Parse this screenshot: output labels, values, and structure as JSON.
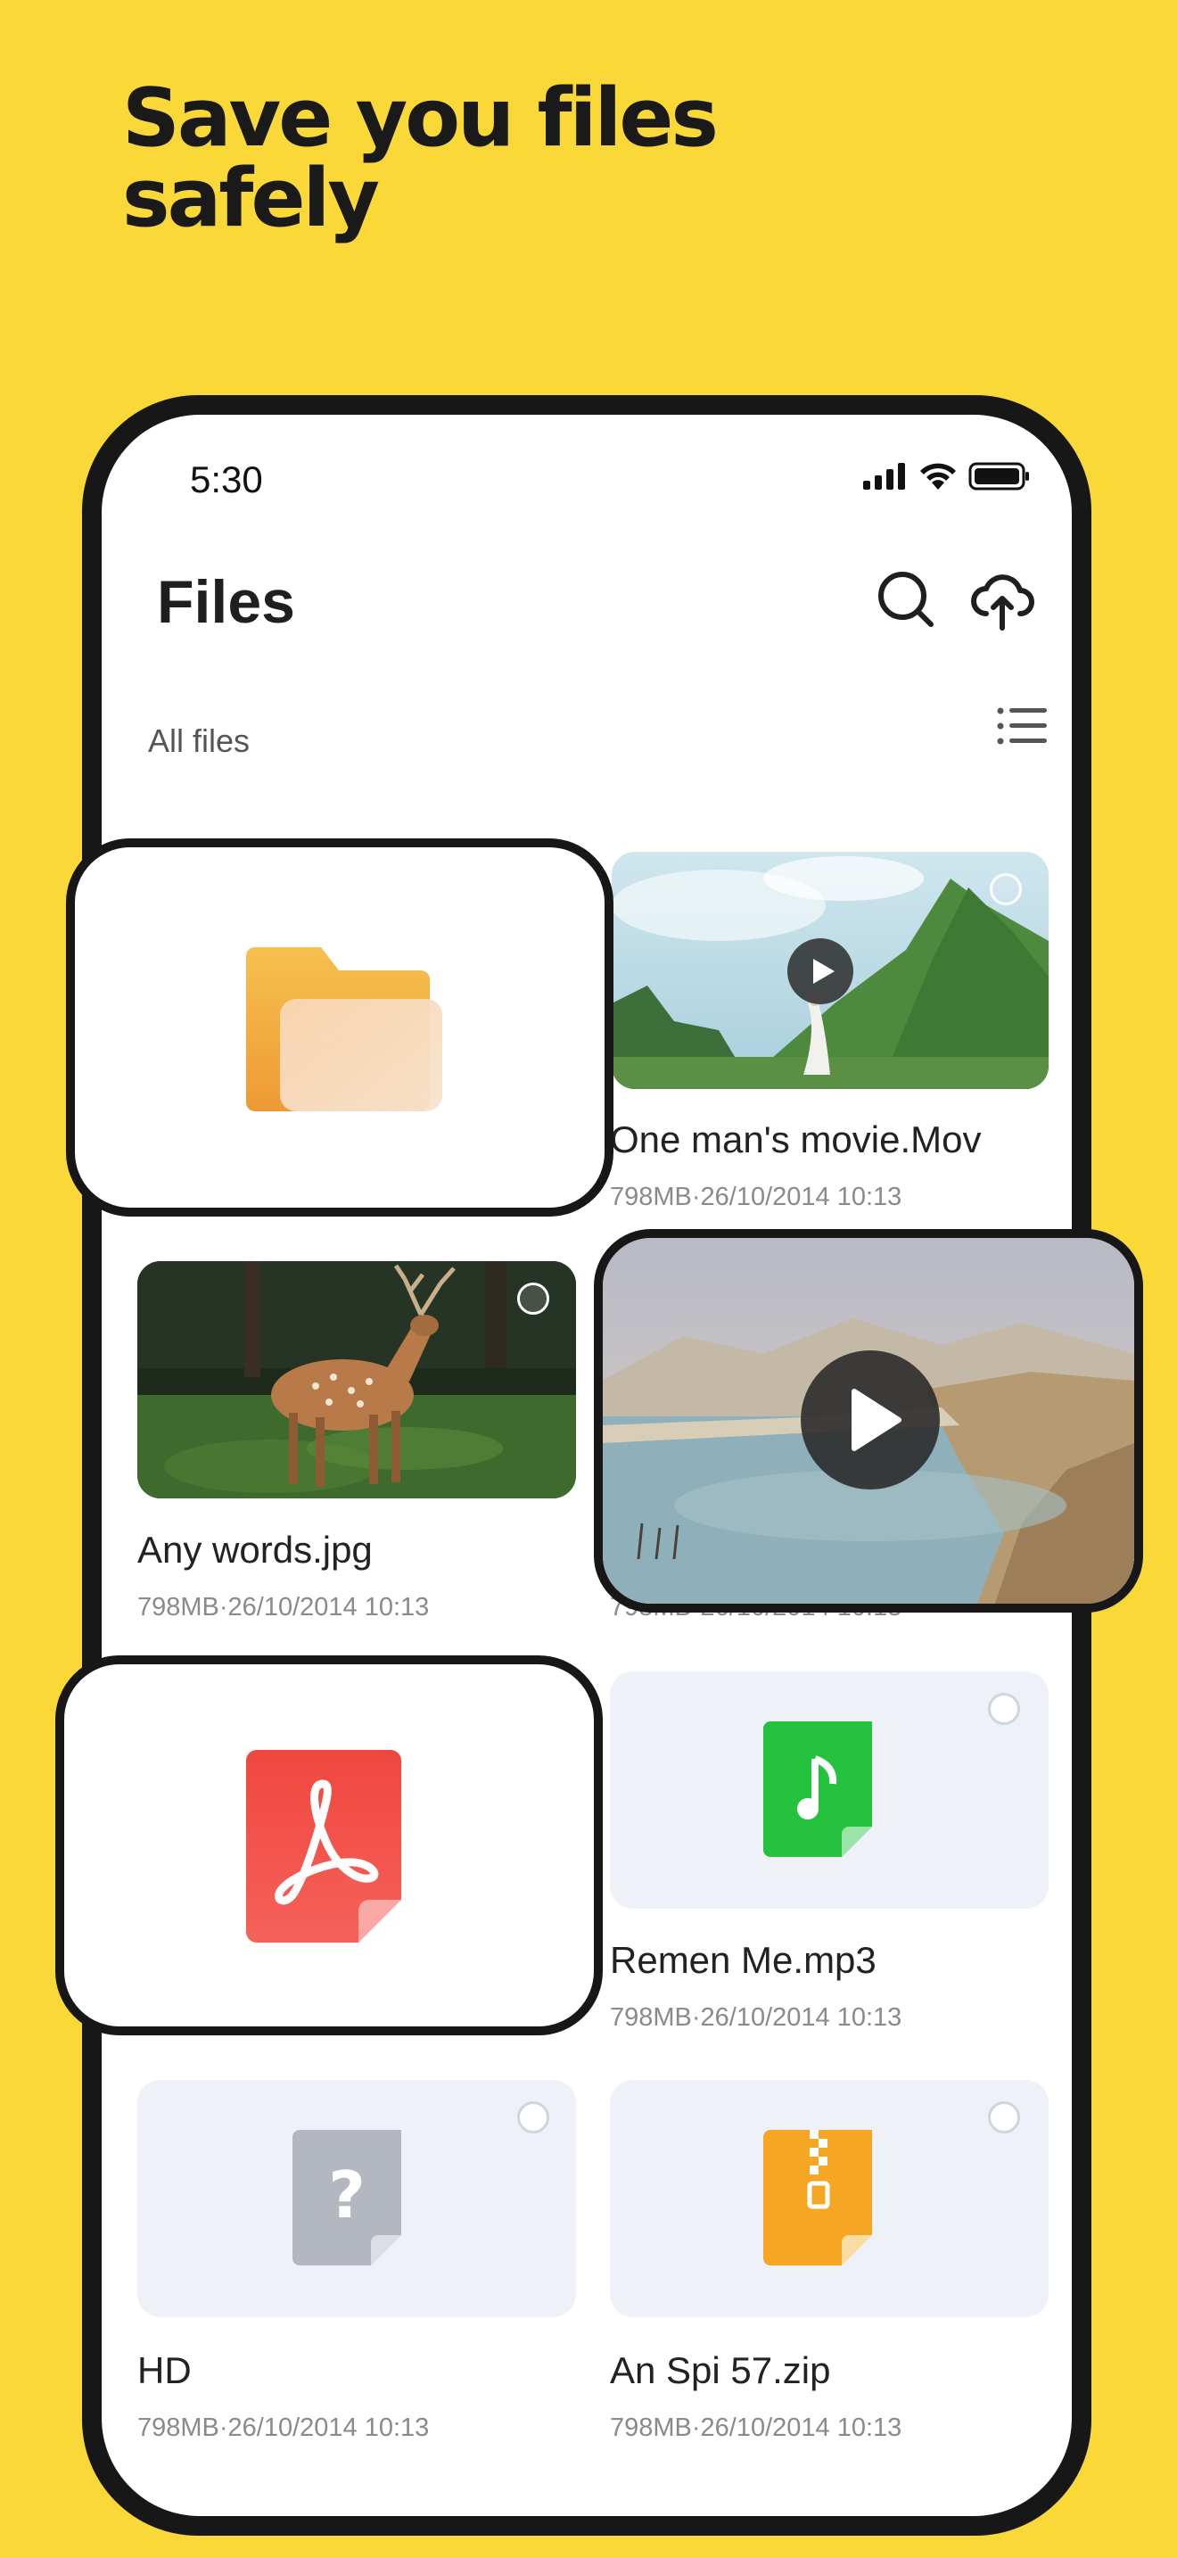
{
  "headline": {
    "line1": "Save you files",
    "line2": "safely"
  },
  "status": {
    "time": "5:30"
  },
  "app": {
    "title": "Files",
    "section": "All files"
  },
  "icons": {
    "search": "search-icon",
    "upload": "cloud-upload-icon",
    "view": "list-view-icon"
  },
  "files": [
    {
      "name": "One man's movie.Mov",
      "meta": "798MB·26/10/2014 10:13",
      "type": "video"
    },
    {
      "name": "Any words.jpg",
      "meta": "798MB·26/10/2014 10:13",
      "type": "image"
    },
    {
      "name": "Remen Me.mp3",
      "meta": "798MB·26/10/2014 10:13",
      "type": "audio"
    },
    {
      "name": " HD",
      "meta": "798MB·26/10/2014 10:13",
      "type": "unknown"
    },
    {
      "name": "An Spi  57.zip",
      "meta": "798MB·26/10/2014 10:13",
      "type": "zip"
    },
    {
      "name": "",
      "meta": "798MB·26/10/2014 10:13",
      "type": "video"
    }
  ],
  "colors": {
    "background": "#F9D838",
    "folder": "#F2A93B",
    "pdf": "#F0473E",
    "audio": "#25C23D",
    "zip": "#F5A623",
    "unknown": "#B3B7BF"
  }
}
